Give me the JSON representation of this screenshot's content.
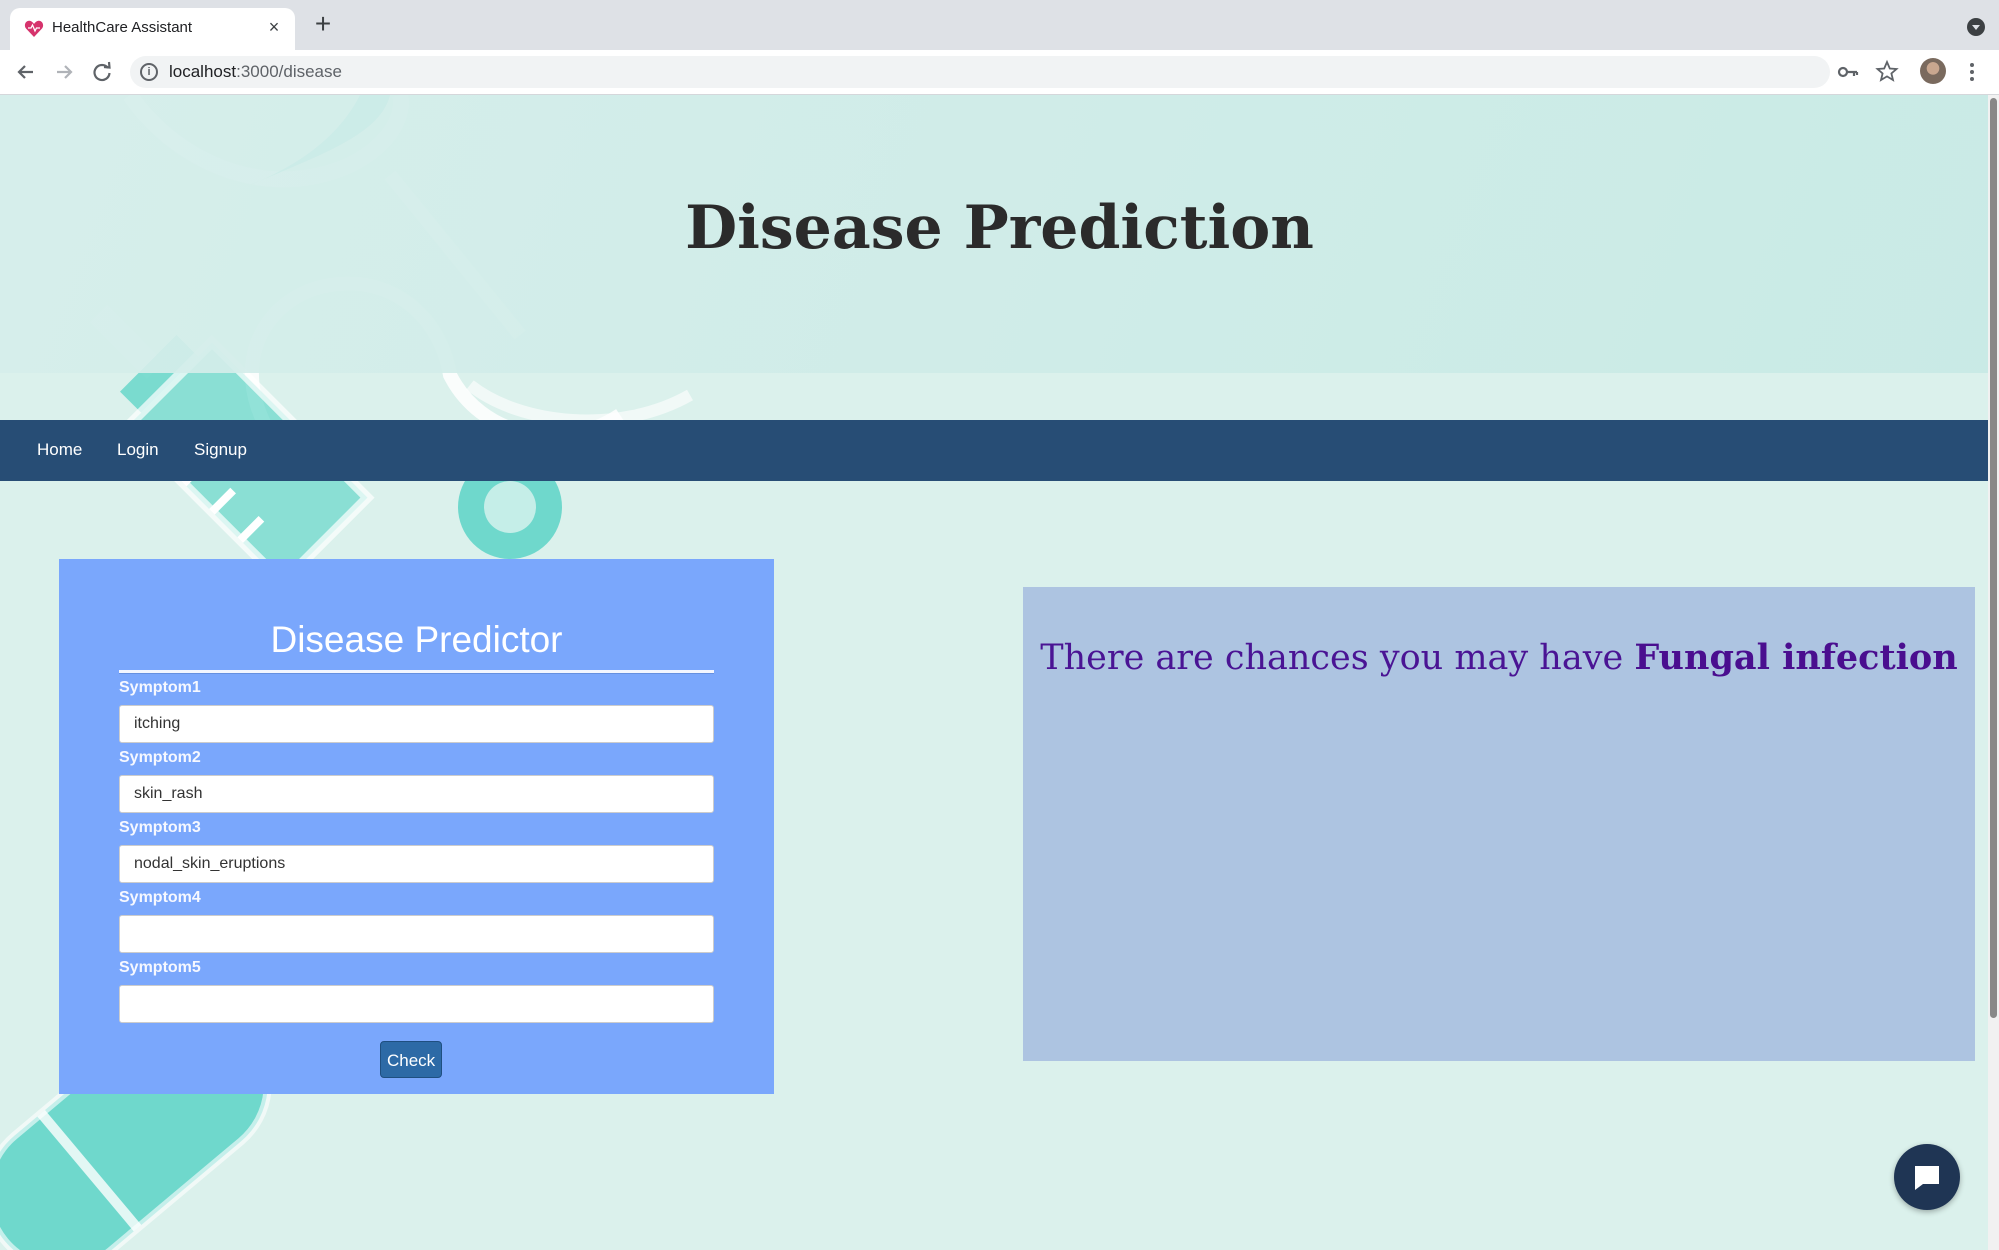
{
  "browser": {
    "tab_title": "HealthCare Assistant",
    "tab_close": "×",
    "new_tab": "+",
    "url_host": "localhost",
    "url_path": ":3000/disease",
    "info_icon": "i"
  },
  "header": {
    "title": "Disease Prediction"
  },
  "navbar": {
    "items": [
      "Home",
      "Login",
      "Signup"
    ]
  },
  "form": {
    "title": "Disease Predictor",
    "fields": [
      {
        "label": "Symptom1",
        "value": "itching"
      },
      {
        "label": "Symptom2",
        "value": "skin_rash"
      },
      {
        "label": "Symptom3",
        "value": "nodal_skin_eruptions"
      },
      {
        "label": "Symptom4",
        "value": ""
      },
      {
        "label": "Symptom5",
        "value": ""
      }
    ],
    "button_label": "Check"
  },
  "result": {
    "prefix": "There are chances you may have ",
    "disease": "Fungal infection"
  },
  "colors": {
    "navbar": "#274d75",
    "form_card": "#7aa7fc",
    "result_card": "#adc4e1",
    "result_text": "#4a1494",
    "page_bg": "#dbf1ec",
    "accent_teal": "#6fd8cc"
  },
  "icons": [
    "heart-favicon-icon",
    "back-icon",
    "forward-icon",
    "reload-icon",
    "info-icon",
    "key-icon",
    "star-icon",
    "more-vert-icon",
    "chat-icon",
    "tab-search-icon"
  ]
}
